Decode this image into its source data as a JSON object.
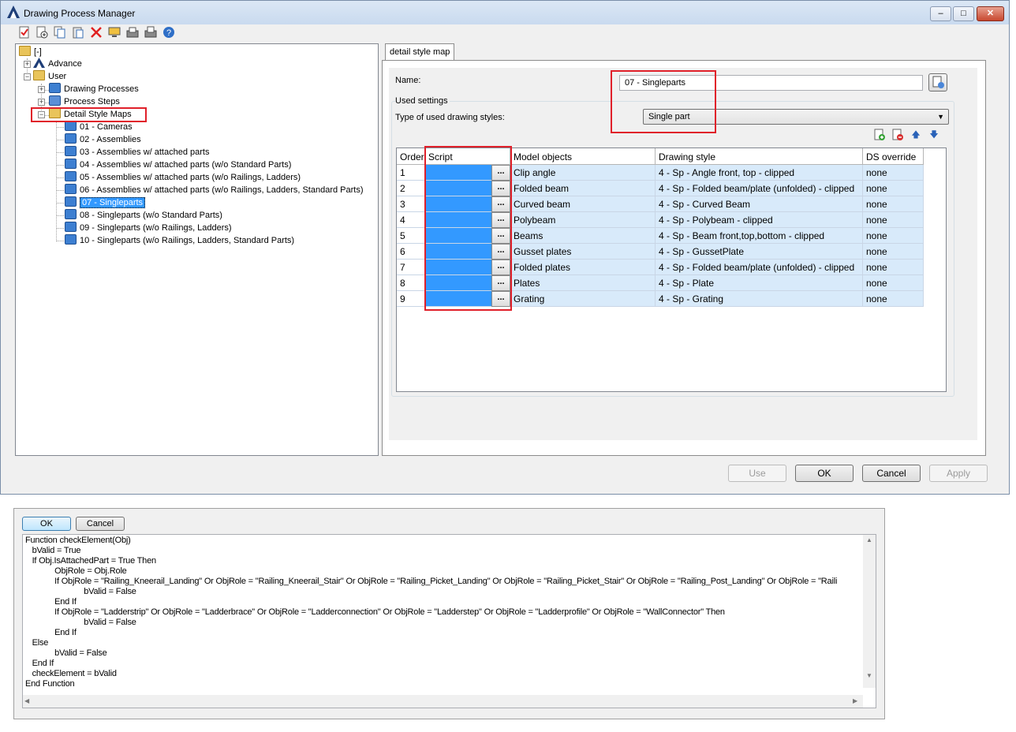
{
  "window": {
    "title": "Drawing Process Manager",
    "controls": {
      "minimize": "–",
      "maximize": "□",
      "close": "✕"
    }
  },
  "toolbar": {
    "icons": [
      "check-icon",
      "new-item-icon",
      "copy-icon",
      "paste-icon",
      "delete-icon",
      "monitor-icon",
      "import-icon",
      "export-icon",
      "help-icon"
    ],
    "delete_glyph": "✕",
    "help_glyph": "?"
  },
  "tree": {
    "root_label": "[-]",
    "advance_label": "Advance",
    "user_label": "User",
    "drawing_processes_label": "Drawing Processes",
    "process_steps_label": "Process Steps",
    "detail_style_maps_label": "Detail Style Maps",
    "maps": [
      "01 - Cameras",
      "02 - Assemblies",
      "03 - Assemblies w/ attached parts",
      "04 - Assemblies w/ attached parts (w/o Standard Parts)",
      "05 - Assemblies w/ attached parts (w/o Railings, Ladders)",
      "06 - Assemblies w/ attached parts (w/o Railings, Ladders, Standard Parts)",
      "07 - Singleparts",
      "08 - Singleparts (w/o Standard Parts)",
      "09 - Singleparts (w/o Railings, Ladders)",
      "10 - Singleparts (w/o Railings, Ladders, Standard Parts)"
    ],
    "selected_index": 6
  },
  "detail": {
    "tab_label": "detail style map",
    "name_label": "Name:",
    "name_value": "07 - Singleparts",
    "used_settings_label": "Used settings",
    "type_label": "Type of used drawing styles:",
    "type_value": "Single part",
    "grid_buttons": {
      "up": "🡅",
      "down": "🡇"
    }
  },
  "grid": {
    "headers": [
      "Order",
      "Script",
      "Model objects",
      "Drawing style",
      "DS override"
    ],
    "ellipsis": "...",
    "rows": [
      {
        "order": "1",
        "model": "Clip angle",
        "style": "4 - Sp - Angle front, top - clipped",
        "override": "none"
      },
      {
        "order": "2",
        "model": "Folded beam",
        "style": "4 - Sp - Folded beam/plate (unfolded) - clipped",
        "override": "none"
      },
      {
        "order": "3",
        "model": "Curved beam",
        "style": "4 - Sp - Curved Beam",
        "override": "none"
      },
      {
        "order": "4",
        "model": "Polybeam",
        "style": "4 - Sp - Polybeam - clipped",
        "override": "none"
      },
      {
        "order": "5",
        "model": "Beams",
        "style": "4 - Sp - Beam front,top,bottom - clipped",
        "override": "none"
      },
      {
        "order": "6",
        "model": "Gusset plates",
        "style": "4 - Sp - GussetPlate",
        "override": "none"
      },
      {
        "order": "7",
        "model": "Folded plates",
        "style": "4 - Sp - Folded beam/plate (unfolded) - clipped",
        "override": "none"
      },
      {
        "order": "8",
        "model": "Plates",
        "style": "4 - Sp - Plate",
        "override": "none"
      },
      {
        "order": "9",
        "model": "Grating",
        "style": "4 - Sp - Grating",
        "override": "none"
      }
    ]
  },
  "buttons": {
    "use": "Use",
    "ok": "OK",
    "cancel": "Cancel",
    "apply": "Apply"
  },
  "editor": {
    "ok": "OK",
    "cancel": "Cancel",
    "lines": [
      "Function checkElement(Obj)",
      "   bValid = True",
      "   If Obj.IsAttachedPart = True Then",
      "             ObjRole = Obj.Role",
      "             If ObjRole = \"Railing_Kneerail_Landing\" Or ObjRole = \"Railing_Kneerail_Stair\" Or ObjRole = \"Railing_Picket_Landing\" Or ObjRole = \"Railing_Picket_Stair\" Or ObjRole = \"Railing_Post_Landing\" Or ObjRole = \"Raili",
      "                          bValid = False",
      "             End If",
      "             If ObjRole = \"Ladderstrip\" Or ObjRole = \"Ladderbrace\" Or ObjRole = \"Ladderconnection\" Or ObjRole = \"Ladderstep\" Or ObjRole = \"Ladderprofile\" Or ObjRole = \"WallConnector\" Then",
      "                          bValid = False",
      "             End If",
      "   Else",
      "             bValid = False",
      "   End If",
      "   checkElement = bValid",
      "End Function"
    ]
  },
  "colors": {
    "selection": "#3399ff",
    "row_fill": "#d8eafa",
    "highlight_box": "#e0202a"
  }
}
